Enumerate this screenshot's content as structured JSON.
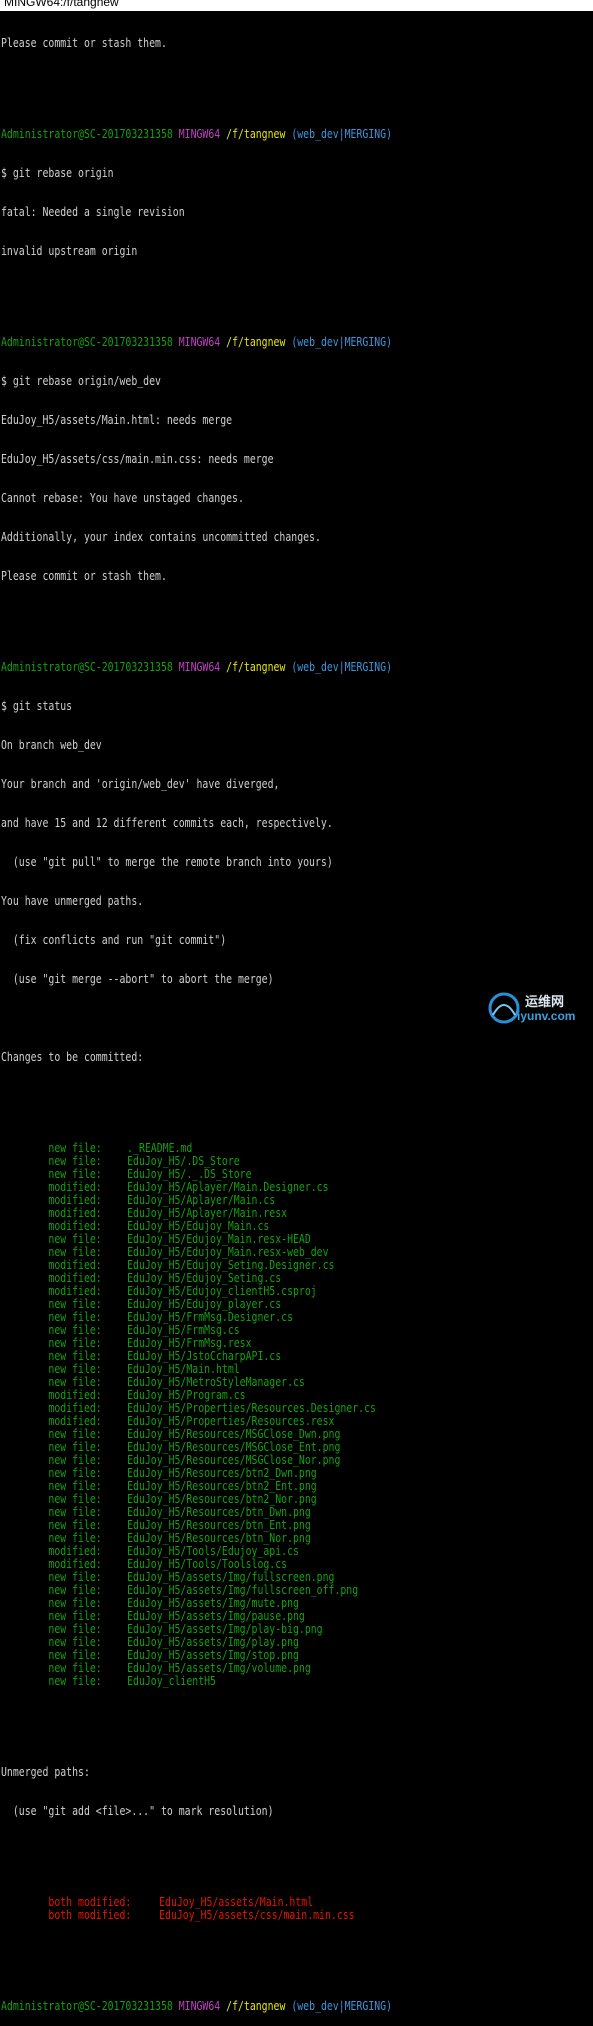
{
  "window": {
    "title": "MINGW64:/f/tangnew"
  },
  "prompt": {
    "user": "Administrator@SC-201703231358",
    "env": "MINGW64",
    "path": "/f/tangnew",
    "branch": "(web_dev|MERGING)"
  },
  "out_top": [
    "Please commit or stash them."
  ],
  "cmd1": "$ git rebase origin",
  "out1": [
    "fatal: Needed a single revision",
    "invalid upstream origin"
  ],
  "cmd2": "$ git rebase origin/web_dev",
  "out2": [
    "EduJoy_H5/assets/Main.html: needs merge",
    "EduJoy_H5/assets/css/main.min.css: needs merge",
    "Cannot rebase: You have unstaged changes.",
    "Additionally, your index contains uncommitted changes.",
    "Please commit or stash them."
  ],
  "cmd3": "$ git status",
  "status_intro": [
    "On branch web_dev",
    "Your branch and 'origin/web_dev' have diverged,",
    "and have 15 and 12 different commits each, respectively.",
    "  (use \"git pull\" to merge the remote branch into yours)",
    "You have unmerged paths.",
    "  (fix conflicts and run \"git commit\")",
    "  (use \"git merge --abort\" to abort the merge)"
  ],
  "changes_header": "Changes to be committed:",
  "staged": [
    {
      "status": "new file:",
      "path": "._README.md"
    },
    {
      "status": "new file:",
      "path": "EduJoy_H5/.DS_Store"
    },
    {
      "status": "new file:",
      "path": "EduJoy_H5/._.DS_Store"
    },
    {
      "status": "modified:",
      "path": "EduJoy_H5/Aplayer/Main.Designer.cs"
    },
    {
      "status": "modified:",
      "path": "EduJoy_H5/Aplayer/Main.cs"
    },
    {
      "status": "modified:",
      "path": "EduJoy_H5/Aplayer/Main.resx"
    },
    {
      "status": "modified:",
      "path": "EduJoy_H5/Edujoy_Main.cs"
    },
    {
      "status": "new file:",
      "path": "EduJoy_H5/Edujoy_Main.resx-HEAD"
    },
    {
      "status": "new file:",
      "path": "EduJoy_H5/Edujoy_Main.resx-web_dev"
    },
    {
      "status": "modified:",
      "path": "EduJoy_H5/Edujoy_Seting.Designer.cs"
    },
    {
      "status": "modified:",
      "path": "EduJoy_H5/Edujoy_Seting.cs"
    },
    {
      "status": "modified:",
      "path": "EduJoy_H5/Edujoy_clientH5.csproj"
    },
    {
      "status": "new file:",
      "path": "EduJoy_H5/Edujoy_player.cs"
    },
    {
      "status": "new file:",
      "path": "EduJoy_H5/FrmMsg.Designer.cs"
    },
    {
      "status": "new file:",
      "path": "EduJoy_H5/FrmMsg.cs"
    },
    {
      "status": "new file:",
      "path": "EduJoy_H5/FrmMsg.resx"
    },
    {
      "status": "new file:",
      "path": "EduJoy_H5/JstoCcharpAPI.cs"
    },
    {
      "status": "new file:",
      "path": "EduJoy_H5/Main.html"
    },
    {
      "status": "new file:",
      "path": "EduJoy_H5/MetroStyleManager.cs"
    },
    {
      "status": "modified:",
      "path": "EduJoy_H5/Program.cs"
    },
    {
      "status": "modified:",
      "path": "EduJoy_H5/Properties/Resources.Designer.cs"
    },
    {
      "status": "modified:",
      "path": "EduJoy_H5/Properties/Resources.resx"
    },
    {
      "status": "new file:",
      "path": "EduJoy_H5/Resources/MSGClose_Dwn.png"
    },
    {
      "status": "new file:",
      "path": "EduJoy_H5/Resources/MSGClose_Ent.png"
    },
    {
      "status": "new file:",
      "path": "EduJoy_H5/Resources/MSGClose_Nor.png"
    },
    {
      "status": "new file:",
      "path": "EduJoy_H5/Resources/btn2_Dwn.png"
    },
    {
      "status": "new file:",
      "path": "EduJoy_H5/Resources/btn2_Ent.png"
    },
    {
      "status": "new file:",
      "path": "EduJoy_H5/Resources/btn2_Nor.png"
    },
    {
      "status": "new file:",
      "path": "EduJoy_H5/Resources/btn_Dwn.png"
    },
    {
      "status": "new file:",
      "path": "EduJoy_H5/Resources/btn_Ent.png"
    },
    {
      "status": "new file:",
      "path": "EduJoy_H5/Resources/btn_Nor.png"
    },
    {
      "status": "modified:",
      "path": "EduJoy_H5/Tools/Edujoy_api.cs"
    },
    {
      "status": "modified:",
      "path": "EduJoy_H5/Tools/Toolslog.cs"
    },
    {
      "status": "new file:",
      "path": "EduJoy_H5/assets/Img/fullscreen.png"
    },
    {
      "status": "new file:",
      "path": "EduJoy_H5/assets/Img/fullscreen_off.png"
    },
    {
      "status": "new file:",
      "path": "EduJoy_H5/assets/Img/mute.png"
    },
    {
      "status": "new file:",
      "path": "EduJoy_H5/assets/Img/pause.png"
    },
    {
      "status": "new file:",
      "path": "EduJoy_H5/assets/Img/play-big.png"
    },
    {
      "status": "new file:",
      "path": "EduJoy_H5/assets/Img/play.png"
    },
    {
      "status": "new file:",
      "path": "EduJoy_H5/assets/Img/stop.png"
    },
    {
      "status": "new file:",
      "path": "EduJoy_H5/assets/Img/volume.png"
    },
    {
      "status": "new file:",
      "path": "EduJoy_clientH5"
    }
  ],
  "unmerged_header": "Unmerged paths:",
  "unmerged_hint": "  (use \"git add <file>...\" to mark resolution)",
  "unmerged": [
    {
      "status": "both modified:",
      "path": "EduJoy_H5/assets/Main.html"
    },
    {
      "status": "both modified:",
      "path": "EduJoy_H5/assets/css/main.min.css"
    }
  ],
  "watermark": {
    "top": "运维网",
    "bottom": "iyunv.com"
  },
  "colors": {
    "background": "#000000",
    "prompt_user": "#13a10e",
    "prompt_env": "#c53ec7",
    "prompt_path": "#e5e510",
    "prompt_branch": "#3a96dd",
    "staged": "#13a10e",
    "unmerged": "#e51400"
  }
}
